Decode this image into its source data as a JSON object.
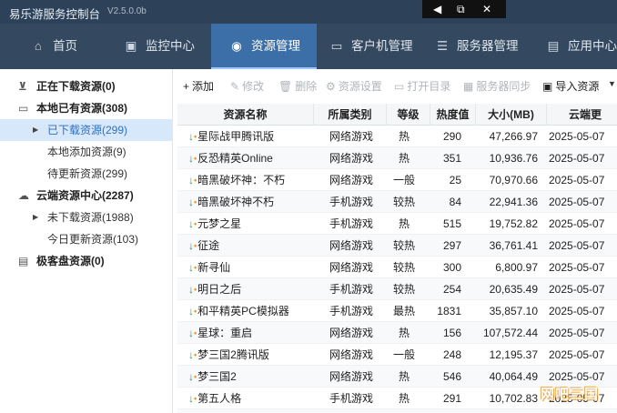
{
  "app": {
    "title": "易乐游服务控制台",
    "version": "V2.5.0.0b"
  },
  "window_controls": [
    {
      "icon": "pin-icon",
      "glyph": "◀"
    },
    {
      "icon": "restore-icon",
      "glyph": "⧉"
    },
    {
      "icon": "close-icon",
      "glyph": "✕"
    }
  ],
  "nav": {
    "tabs": [
      {
        "label": "首页",
        "icon": "home-icon",
        "glyph": "⌂",
        "active": false
      },
      {
        "label": "监控中心",
        "icon": "monitor-chart-icon",
        "glyph": "▣",
        "active": false
      },
      {
        "label": "资源管理",
        "icon": "gamepad-icon",
        "glyph": "◉",
        "active": true
      },
      {
        "label": "客户机管理",
        "icon": "desktop-icon",
        "glyph": "▭",
        "active": false
      },
      {
        "label": "服务器管理",
        "icon": "server-icon",
        "glyph": "☰",
        "active": false
      },
      {
        "label": "应用中心",
        "icon": "briefcase-icon",
        "glyph": "▤",
        "active": false
      }
    ]
  },
  "sidebar": {
    "items": [
      {
        "label": "正在下载资源(0)",
        "icon": "download-icon",
        "glyph": "⊻",
        "bold": true
      },
      {
        "label": "本地已有资源(308)",
        "icon": "folder-icon",
        "glyph": "▭",
        "bold": true
      },
      {
        "label": "已下载资源(299)",
        "selected": true,
        "expandable": true
      },
      {
        "label": "本地添加资源(9)"
      },
      {
        "label": "待更新资源(299)"
      },
      {
        "label": "云端资源中心(2287)",
        "icon": "cloud-icon",
        "glyph": "☁",
        "bold": true
      },
      {
        "label": "未下载资源(1988)",
        "expandable": true
      },
      {
        "label": "今日更新资源(103)"
      },
      {
        "label": "极客盘资源(0)",
        "icon": "disk-icon",
        "glyph": "▤",
        "bold": true
      }
    ]
  },
  "toolbar": {
    "buttons": [
      {
        "label": "添加",
        "glyph": "+",
        "enabled": true
      },
      {
        "label": "修改",
        "glyph": "✎",
        "enabled": false
      },
      {
        "label": "删除",
        "glyph": "🗑",
        "enabled": false
      },
      {
        "label": "资源设置",
        "glyph": "⚙",
        "enabled": false
      },
      {
        "label": "打开目录",
        "glyph": "▭",
        "enabled": false
      },
      {
        "label": "服务器同步",
        "glyph": "▦",
        "enabled": false
      },
      {
        "label": "导入资源",
        "glyph": "▣",
        "enabled": true
      }
    ]
  },
  "table": {
    "columns": [
      "资源名称",
      "所属类别",
      "等级",
      "热度值",
      "大小(MB)",
      "云端更"
    ],
    "rows": [
      {
        "name": "星际战甲腾讯版",
        "category": "网络游戏",
        "level": "热",
        "heat": "290",
        "size": "47,266.97",
        "date": "2025-05-07"
      },
      {
        "name": "反恐精英Online",
        "category": "网络游戏",
        "level": "热",
        "heat": "351",
        "size": "10,936.76",
        "date": "2025-05-07"
      },
      {
        "name": "暗黑破坏神：不朽",
        "category": "网络游戏",
        "level": "一般",
        "heat": "25",
        "size": "70,970.66",
        "date": "2025-05-07"
      },
      {
        "name": "暗黑破坏神不朽",
        "category": "手机游戏",
        "level": "较热",
        "heat": "84",
        "size": "22,941.36",
        "date": "2025-05-07"
      },
      {
        "name": "元梦之星",
        "category": "手机游戏",
        "level": "热",
        "heat": "515",
        "size": "19,752.82",
        "date": "2025-05-07"
      },
      {
        "name": "征途",
        "category": "网络游戏",
        "level": "较热",
        "heat": "297",
        "size": "36,761.41",
        "date": "2025-05-07"
      },
      {
        "name": "新寻仙",
        "category": "网络游戏",
        "level": "较热",
        "heat": "300",
        "size": "6,800.97",
        "date": "2025-05-07"
      },
      {
        "name": "明日之后",
        "category": "手机游戏",
        "level": "较热",
        "heat": "254",
        "size": "20,635.49",
        "date": "2025-05-07"
      },
      {
        "name": "和平精英PC模拟器",
        "category": "手机游戏",
        "level": "最热",
        "heat": "1831",
        "size": "35,857.10",
        "date": "2025-05-07"
      },
      {
        "name": "星球：重启",
        "category": "网络游戏",
        "level": "热",
        "heat": "156",
        "size": "107,572.44",
        "date": "2025-05-07"
      },
      {
        "name": "梦三国2腾讯版",
        "category": "网络游戏",
        "level": "一般",
        "heat": "248",
        "size": "12,195.37",
        "date": "2025-05-07"
      },
      {
        "name": "梦三国2",
        "category": "网络游戏",
        "level": "热",
        "heat": "546",
        "size": "40,064.49",
        "date": "2025-05-07"
      },
      {
        "name": "第五人格",
        "category": "手机游戏",
        "level": "热",
        "heat": "291",
        "size": "10,702.83",
        "date": "2025-05-07"
      },
      {
        "name": "",
        "category": "",
        "level": "",
        "heat": "",
        "size": "",
        "date": ""
      }
    ]
  },
  "watermark": {
    "text": "网吧三国"
  },
  "colors": {
    "titlebar": "#2d4258",
    "navbar": "#34495f",
    "active_tab": "#3c6fa8",
    "selected_row": "#d7e8fb",
    "download_green": "#2e9b4a"
  }
}
